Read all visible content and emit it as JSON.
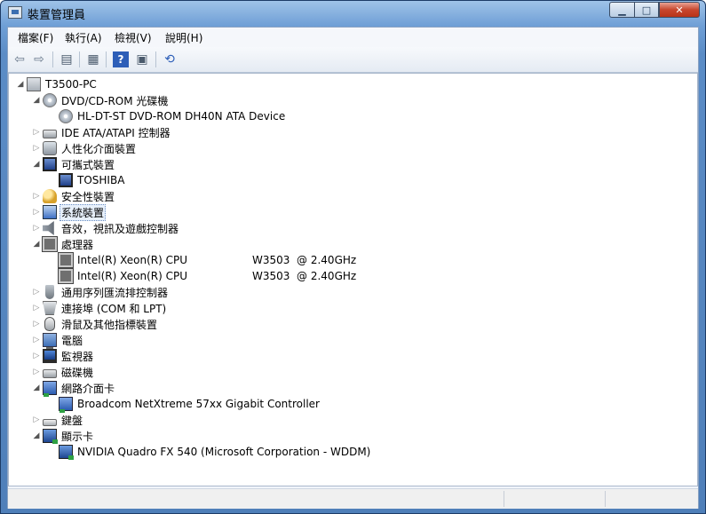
{
  "window": {
    "title": "裝置管理員",
    "buttons": {
      "minimize": "▁",
      "maximize": "□",
      "close": "✕"
    }
  },
  "menu": [
    "檔案(F)",
    "執行(A)",
    "檢視(V)",
    "說明(H)"
  ],
  "toolbar": {
    "icons": [
      "back-icon",
      "forward-icon",
      "show-hide-console-tree-icon",
      "properties-icon",
      "help-icon",
      "action-pane-icon",
      "scan-hardware-icon"
    ],
    "glyphs": {
      "back": "⇦",
      "forward": "⇨",
      "console": "▤",
      "properties": "▦",
      "help": "?",
      "pane": "▣",
      "scan": "⟲"
    }
  },
  "tree": {
    "root": "T3500-PC",
    "nodes": [
      {
        "label": "DVD/CD-ROM 光碟機",
        "icon": "disk-icon",
        "expanded": true,
        "children": [
          "HL-DT-ST DVD-ROM DH40N ATA Device"
        ]
      },
      {
        "label": "IDE ATA/ATAPI 控制器",
        "icon": "ide-controller-icon",
        "expanded": false
      },
      {
        "label": "人性化介面裝置",
        "icon": "hid-icon",
        "expanded": false
      },
      {
        "label": "可攜式裝置",
        "icon": "portable-device-icon",
        "expanded": true,
        "children": [
          "TOSHIBA"
        ]
      },
      {
        "label": "安全性裝置",
        "icon": "security-key-icon",
        "expanded": false
      },
      {
        "label": "系統裝置",
        "icon": "system-device-icon",
        "expanded": false,
        "selected": true
      },
      {
        "label": "音效，視訊及遊戲控制器",
        "icon": "speaker-icon",
        "expanded": false
      },
      {
        "label": "處理器",
        "icon": "processor-icon",
        "expanded": true,
        "children": [
          {
            "name": "Intel(R) Xeon(R) CPU",
            "detail": "W3503  @ 2.40GHz"
          },
          {
            "name": "Intel(R) Xeon(R) CPU",
            "detail": "W3503  @ 2.40GHz"
          }
        ]
      },
      {
        "label": "通用序列匯流排控制器",
        "icon": "usb-icon",
        "expanded": false
      },
      {
        "label": "連接埠 (COM 和 LPT)",
        "icon": "port-icon",
        "expanded": false
      },
      {
        "label": "滑鼠及其他指標裝置",
        "icon": "mouse-icon",
        "expanded": false
      },
      {
        "label": "電腦",
        "icon": "computer-icon",
        "expanded": false
      },
      {
        "label": "監視器",
        "icon": "monitor-icon",
        "expanded": false
      },
      {
        "label": "磁碟機",
        "icon": "disk-drive-icon",
        "expanded": false
      },
      {
        "label": "網路介面卡",
        "icon": "network-adapter-icon",
        "expanded": true,
        "children": [
          "Broadcom NetXtreme 57xx Gigabit Controller"
        ]
      },
      {
        "label": "鍵盤",
        "icon": "keyboard-icon",
        "expanded": false
      },
      {
        "label": "顯示卡",
        "icon": "display-adapter-icon",
        "expanded": true,
        "children": [
          "NVIDIA Quadro FX 540 (Microsoft Corporation - WDDM)"
        ]
      }
    ]
  },
  "statusbar": {
    "text": ""
  }
}
